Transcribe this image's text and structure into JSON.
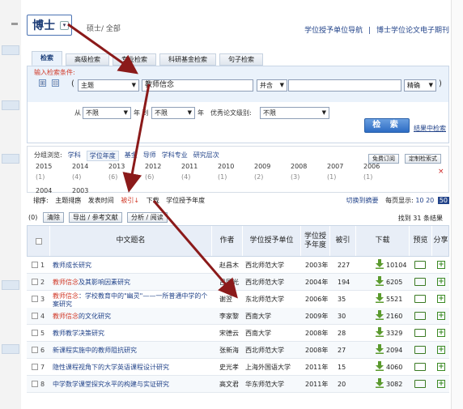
{
  "degree": {
    "label": "博士",
    "dropdown": "▾"
  },
  "breadcrumb": "硕士/ 全部",
  "top_links": [
    "学位授予单位导航",
    "|",
    "博士学位论文电子期刊"
  ],
  "tabs": [
    "检索",
    "高级检索",
    "专业检索",
    "科研基金检索",
    "句子检索"
  ],
  "search": {
    "input_label": "输入检索条件:",
    "plus": "⊞",
    "minus": "⊟",
    "open_paren": "(",
    "field": "主题",
    "term": "教师信念",
    "combine": "并含",
    "term2": "",
    "match": "精确",
    "close_paren": ")",
    "from_label": "从",
    "from_value": "不限",
    "year_label1": "年 到",
    "to_value": "不限",
    "year_label2": "年",
    "excellent_label": "优秀论文级别:",
    "excellent_value": "不限",
    "search_button": "检 索",
    "result_search": "结果中检索"
  },
  "grouping": {
    "label": "分组浏览:",
    "items": [
      "学科",
      "学位年度",
      "基金",
      "导师",
      "学科专业",
      "研究层次"
    ],
    "buttons": [
      "免费订阅",
      "定制检索式"
    ],
    "years": [
      {
        "y": "2015",
        "c": "(1)"
      },
      {
        "y": "2014",
        "c": "(4)"
      },
      {
        "y": "2013",
        "c": "(6)"
      },
      {
        "y": "2012",
        "c": "(6)"
      },
      {
        "y": "2011",
        "c": "(4)"
      },
      {
        "y": "2010",
        "c": "(1)"
      },
      {
        "y": "2009",
        "c": "(2)"
      },
      {
        "y": "2008",
        "c": "(3)"
      },
      {
        "y": "2007",
        "c": "(1)"
      },
      {
        "y": "2006",
        "c": "(1)"
      },
      {
        "y": "2004",
        "c": "(1)"
      },
      {
        "y": "2003",
        "c": "(2)"
      }
    ],
    "close": "×"
  },
  "sort": {
    "label": "排序:",
    "items": [
      "主题排序",
      "发表时间",
      "被引",
      "下载",
      "学位授予年度"
    ],
    "ref_arrow": "↓",
    "switch": "切换到摘要",
    "per_page": "每页显示:",
    "pages": [
      "10",
      "20",
      "50"
    ]
  },
  "actions": {
    "zero": "(0)",
    "clear": "清除",
    "export": "导出 / 参考文献",
    "analyze": "分析 / 阅读",
    "found": "找到 31 条结果"
  },
  "table": {
    "headers": [
      "中文题名",
      "作者",
      "学位授予单位",
      "学位授予年度",
      "被引",
      "下载",
      "预览",
      "分享"
    ],
    "rows": [
      {
        "n": "1",
        "t1": "",
        "t2": "教师成长研究",
        "author": "赵昌木",
        "unit": "西北师范大学",
        "year": "2003年",
        "cite": "227",
        "dl": "10104"
      },
      {
        "n": "2",
        "t1": "教师信念",
        "t2": "及其影响因素研究",
        "author": "吕国光",
        "unit": "西北师范大学",
        "year": "2004年",
        "cite": "194",
        "dl": "6205"
      },
      {
        "n": "3",
        "t1": "教师信念",
        "t2": "：学校教育中的\"幽灵\"——一所普通中学的个案研究",
        "author": "谢翌",
        "unit": "东北师范大学",
        "year": "2006年",
        "cite": "35",
        "dl": "5521"
      },
      {
        "n": "4",
        "t1": "教师信念",
        "t2": "的文化研究",
        "author": "李家黎",
        "unit": "西南大学",
        "year": "2009年",
        "cite": "30",
        "dl": "2160"
      },
      {
        "n": "5",
        "t1": "",
        "t2": "教师教学决策研究",
        "author": "宋德云",
        "unit": "西南大学",
        "year": "2008年",
        "cite": "28",
        "dl": "3329"
      },
      {
        "n": "6",
        "t1": "",
        "t2": "新课程实施中的教师阻抗研究",
        "author": "张新海",
        "unit": "西北师范大学",
        "year": "2008年",
        "cite": "27",
        "dl": "2094"
      },
      {
        "n": "7",
        "t1": "",
        "t2": "隐性课程视角下的大学英语课程设计研究",
        "author": "史光孝",
        "unit": "上海外国语大学",
        "year": "2011年",
        "cite": "15",
        "dl": "4060"
      },
      {
        "n": "8",
        "t1": "",
        "t2": "中学数学课堂探究水平的构建与实证研究",
        "author": "高文君",
        "unit": "华东师范大学",
        "year": "2011年",
        "cite": "20",
        "dl": "3082"
      }
    ]
  },
  "colors": {
    "accent": "#23448a",
    "highlight": "#d13b2a",
    "arrow": "#8b1a1a"
  }
}
